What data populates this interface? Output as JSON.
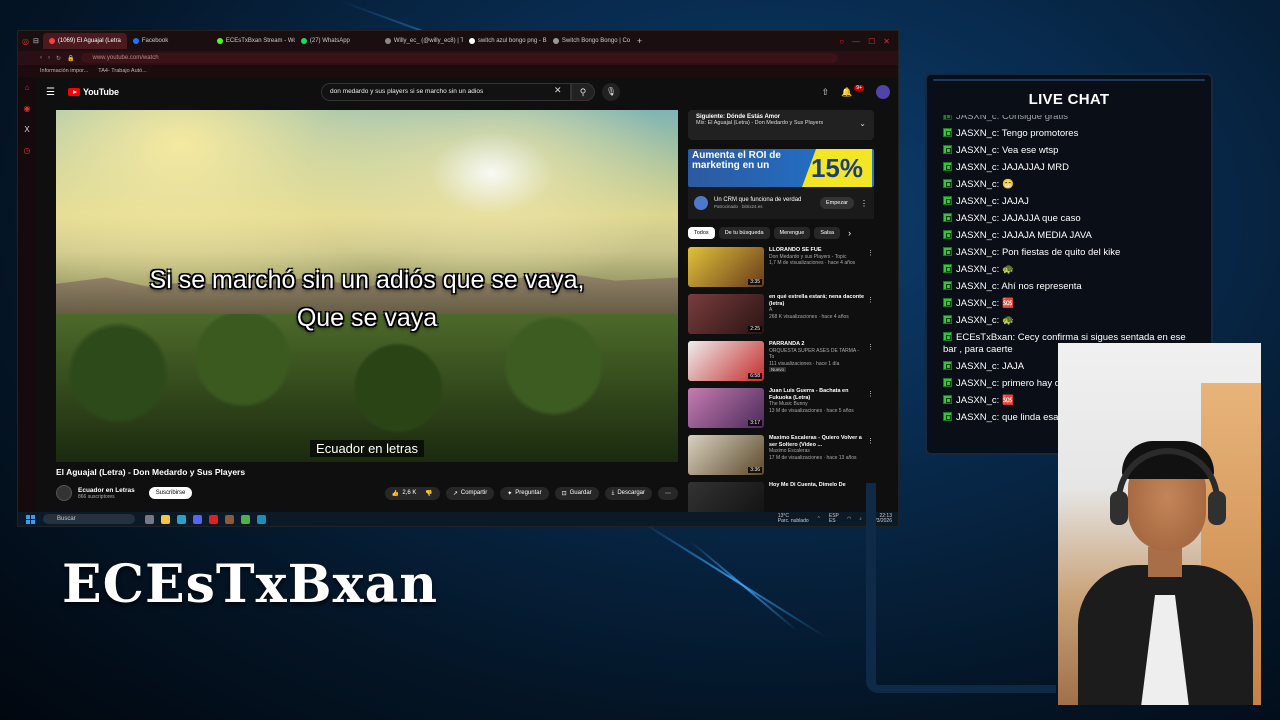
{
  "browser": {
    "tabs": [
      {
        "label": "(1069) El Aguajal (Letra",
        "active": true,
        "color": "#ff3b3b"
      },
      {
        "label": "Facebook",
        "active": false,
        "color": "#1877f2"
      },
      {
        "label": "ECEsTxBxan Stream - Wo",
        "active": false,
        "color": "#53fc18"
      },
      {
        "label": "(27) WhatsApp",
        "active": false,
        "color": "#25d366"
      },
      {
        "label": "Willy_ec_ (@willy_ec8) | T",
        "active": false,
        "color": "#888888"
      },
      {
        "label": "switch azul bongo png - B",
        "active": false,
        "color": "#ffffff"
      },
      {
        "label": "Switch Bongo Bongo | Co",
        "active": false,
        "color": "#999999"
      }
    ],
    "new_tab_icon": "plus-icon",
    "address": "www.youtube.com/watch",
    "bookmarks": [
      "Información impor...",
      "TA4- Trabajo Autó..."
    ]
  },
  "youtube": {
    "logo_text": "YouTube",
    "search_query": "don medardo y sus players si se marcho sin un adios",
    "notification_count": "9+",
    "video": {
      "lyric_line1": "Si se marchó sin un adiós que se vaya,",
      "lyric_line2": "Que se vaya",
      "caption": "Ecuador en letras",
      "title": "El Aguajal (Letra) - Don Medardo y Sus Players",
      "channel_name": "Ecuador en Letras",
      "channel_subs": "866 suscriptores",
      "subscribe_label": "Suscribirse",
      "likes": "2,6 K",
      "share_label": "Compartir",
      "ask_label": "Preguntar",
      "save_label": "Guardar",
      "download_label": "Descargar"
    },
    "next_up": {
      "label": "Siguiente: Dónde Estás Amor",
      "mix": "Mix: El Aguajal (Letra) - Don Medardo y Sus Players"
    },
    "ad": {
      "banner_text": "Aumenta el ROI de marketing en un",
      "banner_pct": "15%",
      "title": "Un CRM que funciona de verdad",
      "sponsor": "Patrocinado · bitrix24.es",
      "cta": "Empezar"
    },
    "chips": [
      "Todos",
      "De tu búsqueda",
      "Merengue",
      "Salsa"
    ],
    "recommendations": [
      {
        "title": "LLORANDO SE FUE",
        "channel": "Don Medardo y sus Players - Topic",
        "meta": "1,7 M de visualizaciones · hace 4 años",
        "duration": "3:35",
        "color1": "#e0c23a",
        "color2": "#6a3b1b"
      },
      {
        "title": "en qué estrella estará; nena daconte (letra)",
        "channel": "A",
        "meta": "268 K visualizaciones · hace 4 años",
        "duration": "2:25",
        "color1": "#7a3d3d",
        "color2": "#2a1414"
      },
      {
        "title": "PARRANDA 2",
        "channel": "ORQUESTA SUPER ASES DE TARMA - To",
        "meta": "111 visualizaciones · hace 1 día",
        "badge": "Nuevo",
        "duration": "6:58",
        "color1": "#eeeeee",
        "color2": "#c42d2d"
      },
      {
        "title": "Juan Luis Guerra - Bachata en Fukuoka (Letra)",
        "channel": "The Music Bunny",
        "meta": "13 M de visualizaciones · hace 5 años",
        "duration": "3:17",
        "color1": "#c77bb1",
        "color2": "#4a2c5a"
      },
      {
        "title": "Maximo Escaleras - Quiero Volver a ser Soltero (Video ...",
        "channel": "Maximo Escaleras",
        "meta": "17 M de visualizaciones · hace 13 años",
        "duration": "3:36",
        "color1": "#d9d2c0",
        "color2": "#5c4a2c"
      },
      {
        "title": "Hoy Me Di Cuenta, Dimelo De",
        "channel": "",
        "meta": "",
        "duration": "",
        "color1": "#333333",
        "color2": "#111111"
      }
    ]
  },
  "taskbar": {
    "search_placeholder": "Buscar",
    "weather_temp": "13°C",
    "weather_desc": "Parc. nublado",
    "lang": "ESP",
    "lang_sub": "ES",
    "time": "22:13",
    "date": "28/3/2026"
  },
  "chat": {
    "header": "LIVE CHAT",
    "messages": [
      {
        "user": "JASXN_c:",
        "text": "Consigue gratis"
      },
      {
        "user": "JASXN_c:",
        "text": "Tengo promotores"
      },
      {
        "user": "JASXN_c:",
        "text": "Vea ese wtsp"
      },
      {
        "user": "JASXN_c:",
        "text": "JAJAJJAJ MRD"
      },
      {
        "user": "JASXN_c:",
        "text": "😁"
      },
      {
        "user": "JASXN_c:",
        "text": "JAJAJ"
      },
      {
        "user": "JASXN_c:",
        "text": "JAJAJJA que caso"
      },
      {
        "user": "JASXN_c:",
        "text": "JAJAJA MEDIA JAVA"
      },
      {
        "user": "JASXN_c:",
        "text": "Pon fiestas de quito del kike"
      },
      {
        "user": "JASXN_c:",
        "text": "🐢"
      },
      {
        "user": "JASXN_c:",
        "text": "Ahí nos representa"
      },
      {
        "user": "JASXN_c:",
        "text": "🆘"
      },
      {
        "user": "JASXN_c:",
        "text": "🐢"
      },
      {
        "user": "ECEsTxBxan:",
        "text": "Cecy confirma si sigues sentada en ese bar , para caerte"
      },
      {
        "user": "JASXN_c:",
        "text": "JAJA"
      },
      {
        "user": "JASXN_c:",
        "text": "primero hay que pedir y después te ajusticias"
      },
      {
        "user": "JASXN_c:",
        "text": "🆘"
      },
      {
        "user": "JASXN_c:",
        "text": "que linda esa"
      }
    ]
  },
  "overlay": {
    "streamer_name": "ECEsTxBxan"
  }
}
